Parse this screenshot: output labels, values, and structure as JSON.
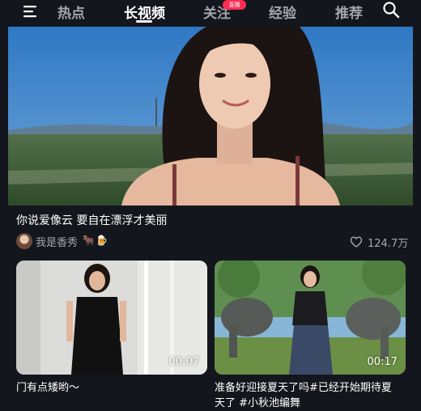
{
  "tabs": [
    {
      "label": "热点",
      "active": false
    },
    {
      "label": "长视频",
      "active": true
    },
    {
      "label": "关注",
      "active": false
    },
    {
      "label": "经验",
      "active": false
    },
    {
      "label": "推荐",
      "active": false
    }
  ],
  "live_badge": "直播",
  "featured": {
    "title": "你说爱像云 要自在漂浮才美丽",
    "author": "我是香秀",
    "author_emojis": [
      "🐂",
      "🍺"
    ],
    "likes": "124.7万",
    "controls": [
      "picture-in-picture-icon",
      "mute-icon",
      "rotate-icon"
    ]
  },
  "cards": [
    {
      "duration": "00:07",
      "title": "门有点矮哟～"
    },
    {
      "duration": "00:17",
      "title_line1": "准备好迎接夏天了吗#已经开始期待夏",
      "title_line2": "天了 #小秋池编舞"
    }
  ],
  "colors": {
    "background": "#14161d",
    "live_badge": "#fe2c55",
    "muted_text": "#a3a6ad"
  }
}
